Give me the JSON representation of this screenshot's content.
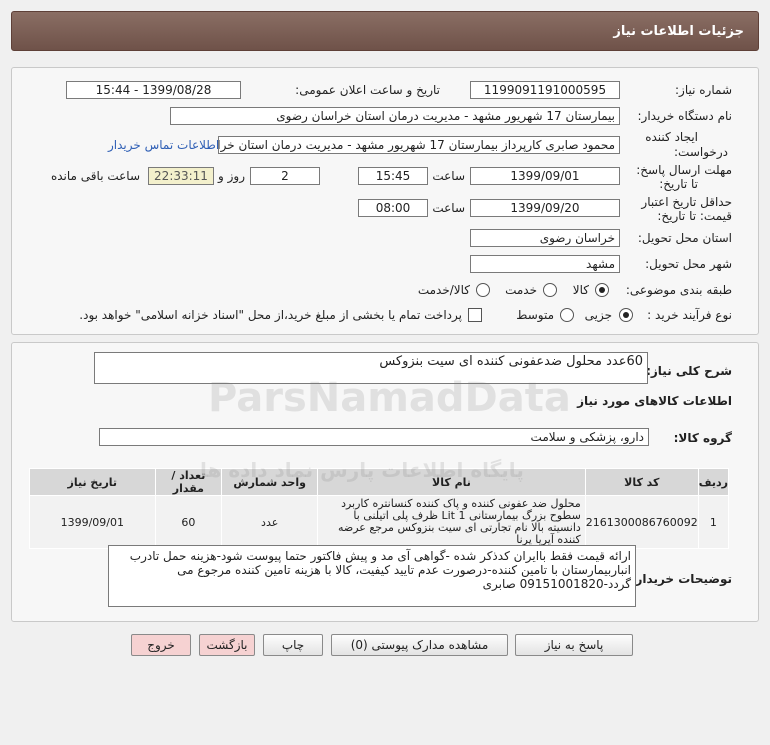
{
  "header": {
    "title": "جزئیات اطلاعات نیاز"
  },
  "form": {
    "need_number_label": "شماره نیاز:",
    "need_number": "1199091191000595",
    "announce_label": "تاریخ و ساعت اعلان عمومی:",
    "announce_value": "1399/08/28 - 15:44",
    "buyer_org_label": "نام دستگاه خریدار:",
    "buyer_org": "بیمارستان 17 شهریور مشهد - مدیریت درمان استان خراسان رضوی",
    "creator_label_1": "ایجاد کننده",
    "creator_label_2": "درخواست:",
    "creator": "محمود صابری کارپرداز بیمارستان 17 شهریور مشهد - مدیریت درمان استان خراسان",
    "contact_link": "اطلاعات تماس خریدار",
    "deadline_label_1": "مهلت ارسال پاسخ:",
    "deadline_label_2": "تا تاریخ:",
    "deadline_date": "1399/09/01",
    "time_label": "ساعت",
    "deadline_time": "15:45",
    "days_value": "2",
    "days_label": "روز و",
    "remaining_time": "22:33:11",
    "remaining_label": "ساعت باقی مانده",
    "validity_label_1": "حداقل تاریخ اعتبار",
    "validity_label_2": "قیمت: تا تاریخ:",
    "validity_date": "1399/09/20",
    "validity_time_label": "ساعت",
    "validity_time": "08:00",
    "province_label": "استان محل تحویل:",
    "province": "خراسان رضوی",
    "city_label": "شهر محل تحویل:",
    "city": "مشهد",
    "category_label": "طبقه بندی موضوعی:",
    "category_options": [
      "کالا",
      "خدمت",
      "کالا/خدمت"
    ],
    "process_label": "نوع فرآیند خرید :",
    "process_options": [
      "جزیی",
      "متوسط"
    ],
    "payment_note": "پرداخت تمام یا بخشی از مبلغ خرید،از محل \"اسناد خزانه اسلامی\" خواهد بود."
  },
  "summary": {
    "label": "شرح کلی نیاز:",
    "value": "60عدد محلول ضدعفونی کننده ای سیت بنزوکس",
    "goods_info_title": "اطلاعات کالاهای مورد نیاز",
    "group_label": "گروه کالا:",
    "group_value": "دارو، پزشکی و سلامت"
  },
  "table": {
    "headers": [
      "ردیف",
      "کد کالا",
      "نام کالا",
      "واحد شمارش",
      "تعداد / مقدار",
      "تاریخ نیاز"
    ],
    "rows": [
      {
        "index": "1",
        "code": "2161300086760092",
        "name": "محلول ضد عفونی کننده و پاک کننده کنسانتره کاربرد سطوح بزرگ بیمارستانی Lit 1 ظرف پلی اتیلنی با دانسیته بالا نام تجارتی ای سیت بنزوکس مرجع عرضه کننده آیریا پرنا",
        "unit": "عدد",
        "qty": "60",
        "date": "1399/09/01"
      }
    ]
  },
  "buyer_notes": {
    "label": "توضیحات خریدار:",
    "text": "ارائه قیمت فقط باایران کدذکر شده -گواهی آی مد و پیش فاکتور حتما پیوست شود-هزینه حمل تادرب انباربیمارستان با تامین کننده-درصورت عدم تایید کیفیت، کالا با هزینه تامین کننده مرجوع می گردد-09151001820 صابری"
  },
  "buttons": {
    "reply": "پاسخ به نیاز",
    "attachments": "مشاهده مدارک پیوستی (0)",
    "print": "چاپ",
    "back": "بازگشت",
    "exit": "خروج"
  },
  "watermark": {
    "brand": "ParsNamadData",
    "tagline": "پایگاه اطلاعات پارس نماد داده ها"
  }
}
